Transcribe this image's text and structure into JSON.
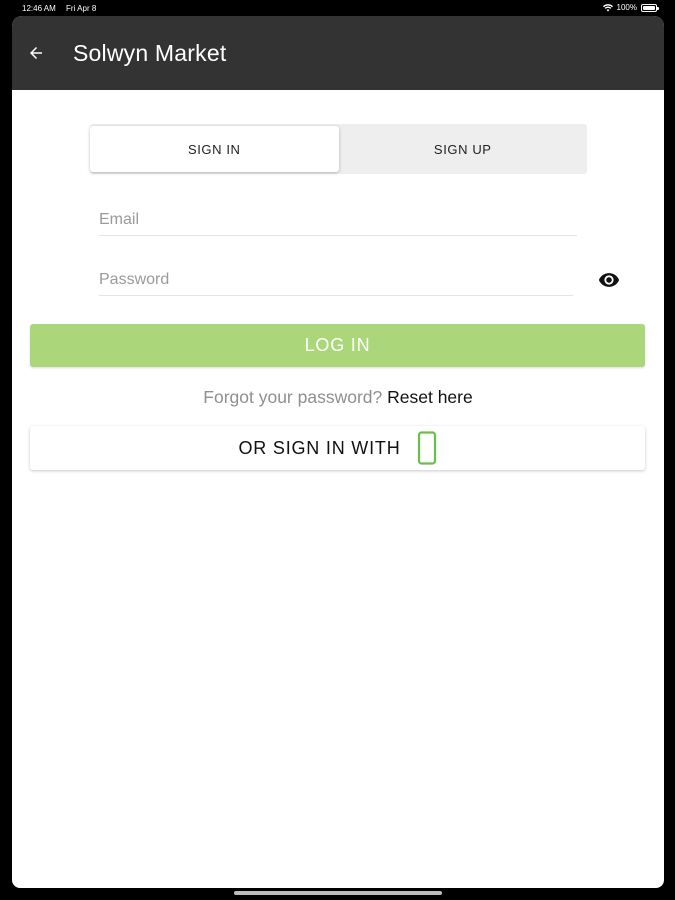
{
  "status_bar": {
    "time": "12:46 AM",
    "date": "Fri Apr 8",
    "battery": "100%"
  },
  "app_bar": {
    "title": "Solwyn Market",
    "back_icon": "arrow-left-icon",
    "background": "#333333"
  },
  "auth_tabs": [
    {
      "label": "SIGN IN",
      "active": true
    },
    {
      "label": "SIGN UP",
      "active": false
    }
  ],
  "form": {
    "email": {
      "value": "",
      "placeholder": "Email"
    },
    "password": {
      "value": "",
      "placeholder": "Password"
    },
    "visibility_icon": "eye-icon"
  },
  "login_button": {
    "label": "LOG IN",
    "color": "#acd67a"
  },
  "forgot": {
    "prompt": "Forgot your password?",
    "link": "Reset here"
  },
  "alt_signin": {
    "label": "OR SIGN IN WITH",
    "icon": "phone-icon",
    "icon_color": "#6abf4b"
  }
}
